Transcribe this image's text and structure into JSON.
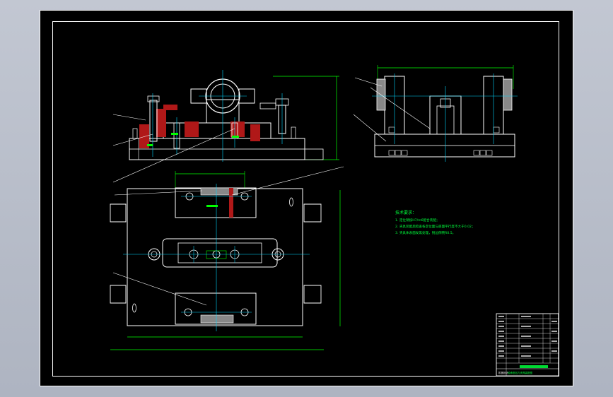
{
  "drawing": {
    "tech_requirements": {
      "title": "技术要求：",
      "items": [
        "1. 定位销按H7/m6配合装配；",
        "2. 夹具装配后检查各定位面与底面平行度不大于0.02；",
        "3. 夹具体表面发黑处理，锐边倒钝R0.5。"
      ]
    },
    "title_block": {
      "drawing_name": "轴承座钻孔夹具装配图",
      "company": "机械设计"
    }
  },
  "colors": {
    "background": "#000000",
    "outline": "#ffffff",
    "dimension": "#00ff00",
    "centerline": "#00d7ff",
    "section": "#b01818",
    "notes": "#00ff3c"
  }
}
